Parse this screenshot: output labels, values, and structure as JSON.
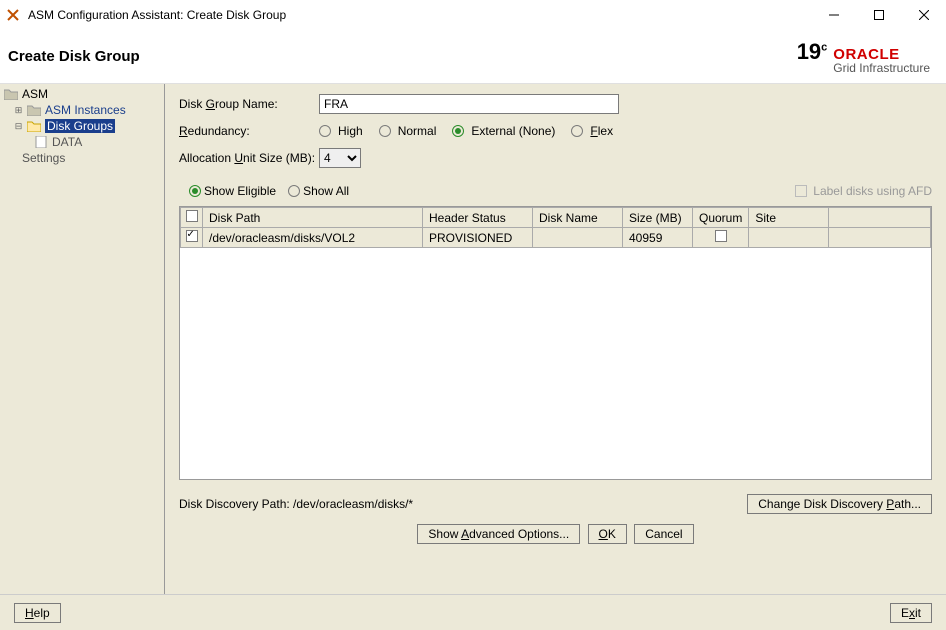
{
  "window": {
    "title": "ASM Configuration Assistant: Create Disk Group"
  },
  "header": {
    "page_title": "Create Disk Group",
    "logo_version_main": "19",
    "logo_version_sup": "c",
    "logo_brand": "ORACLE",
    "logo_sub": "Grid Infrastructure"
  },
  "tree": {
    "root": "ASM",
    "instances": "ASM Instances",
    "disk_groups": "Disk Groups",
    "data": "DATA",
    "settings": "Settings"
  },
  "form": {
    "disk_group_name_label_pre": "Disk ",
    "disk_group_name_label_u": "G",
    "disk_group_name_label_post": "roup Name:",
    "disk_group_name_value": "FRA",
    "redundancy_label_u": "R",
    "redundancy_label_post": "edundancy:",
    "redundancy_options": {
      "high": "High",
      "normal": "Normal",
      "external": "External (None)",
      "flex_u": "F",
      "flex_post": "lex"
    },
    "redundancy_selected": "external",
    "au_label_pre": "Allocation ",
    "au_label_u": "U",
    "au_label_post": "nit Size (MB):",
    "au_value": "4",
    "show_eligible_pre": "Show ",
    "show_eligible_u": "E",
    "show_eligible_post": "ligible",
    "show_all_u": "S",
    "show_all_post": "how All",
    "filter_selected": "eligible",
    "afd_label_u": "L",
    "afd_label_post": "abel disks using AFD"
  },
  "table": {
    "columns": {
      "path": "Disk Path",
      "header_status": "Header Status",
      "disk_name": "Disk Name",
      "size": "Size (MB)",
      "quorum": "Quorum",
      "site": "Site"
    },
    "rows": [
      {
        "checked": true,
        "path": "/dev/oracleasm/disks/VOL2",
        "header_status": "PROVISIONED",
        "disk_name": "",
        "size": "40959",
        "quorum": false,
        "site": ""
      }
    ]
  },
  "discovery": {
    "label": "Disk Discovery Path: ",
    "value": "/dev/oracleasm/disks/*",
    "change_btn_pre": "Change Disk Discovery ",
    "change_btn_u": "P",
    "change_btn_post": "ath..."
  },
  "actions": {
    "advanced_pre": "Show ",
    "advanced_u": "A",
    "advanced_post": "dvanced Options...",
    "ok_u": "O",
    "ok_post": "K",
    "cancel": "Cancel"
  },
  "footer": {
    "help_u": "H",
    "help_post": "elp",
    "exit_pre": "E",
    "exit_u": "x",
    "exit_post": "it"
  }
}
